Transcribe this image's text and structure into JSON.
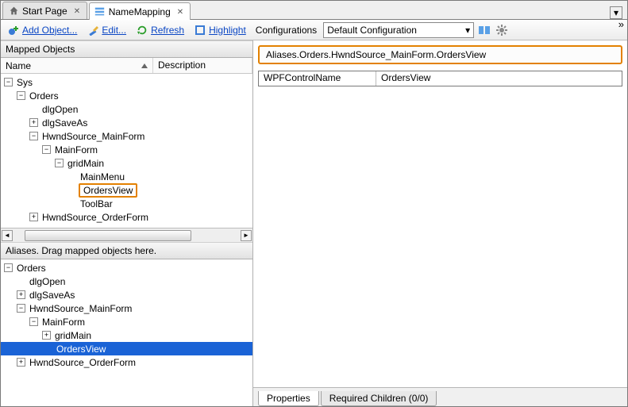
{
  "tabs": {
    "start": "Start Page",
    "namemapping": "NameMapping"
  },
  "toolbar": {
    "add": "Add Object...",
    "edit": "Edit...",
    "refresh": "Refresh",
    "highlight": "Highlight",
    "configs": "Configurations",
    "config_selected": "Default Configuration"
  },
  "panels": {
    "mapped_title": "Mapped Objects",
    "aliases_title": "Aliases. Drag mapped objects here.",
    "col_name": "Name",
    "col_desc": "Description"
  },
  "mapped_tree": {
    "sys": "Sys",
    "orders": "Orders",
    "dlgOpen": "dlgOpen",
    "dlgSaveAs": "dlgSaveAs",
    "hwndMain": "HwndSource_MainForm",
    "mainForm": "MainForm",
    "gridMain": "gridMain",
    "mainMenu": "MainMenu",
    "ordersView": "OrdersView",
    "toolBar": "ToolBar",
    "hwndOrder": "HwndSource_OrderForm"
  },
  "aliases_tree": {
    "orders": "Orders",
    "dlgOpen": "dlgOpen",
    "dlgSaveAs": "dlgSaveAs",
    "hwndMain": "HwndSource_MainForm",
    "mainForm": "MainForm",
    "gridMain": "gridMain",
    "ordersView": "OrdersView",
    "hwndOrder": "HwndSource_OrderForm"
  },
  "right": {
    "path": "Aliases.Orders.HwndSource_MainForm.OrdersView",
    "prop_name": "WPFControlName",
    "prop_value": "OrdersView"
  },
  "bottom_tabs": {
    "properties": "Properties",
    "required": "Required Children (0/0)"
  },
  "glyphs": {
    "minus": "−",
    "plus": "+",
    "close": "✕",
    "down": "▾",
    "left": "◄",
    "right": "►",
    "chev": "»"
  }
}
